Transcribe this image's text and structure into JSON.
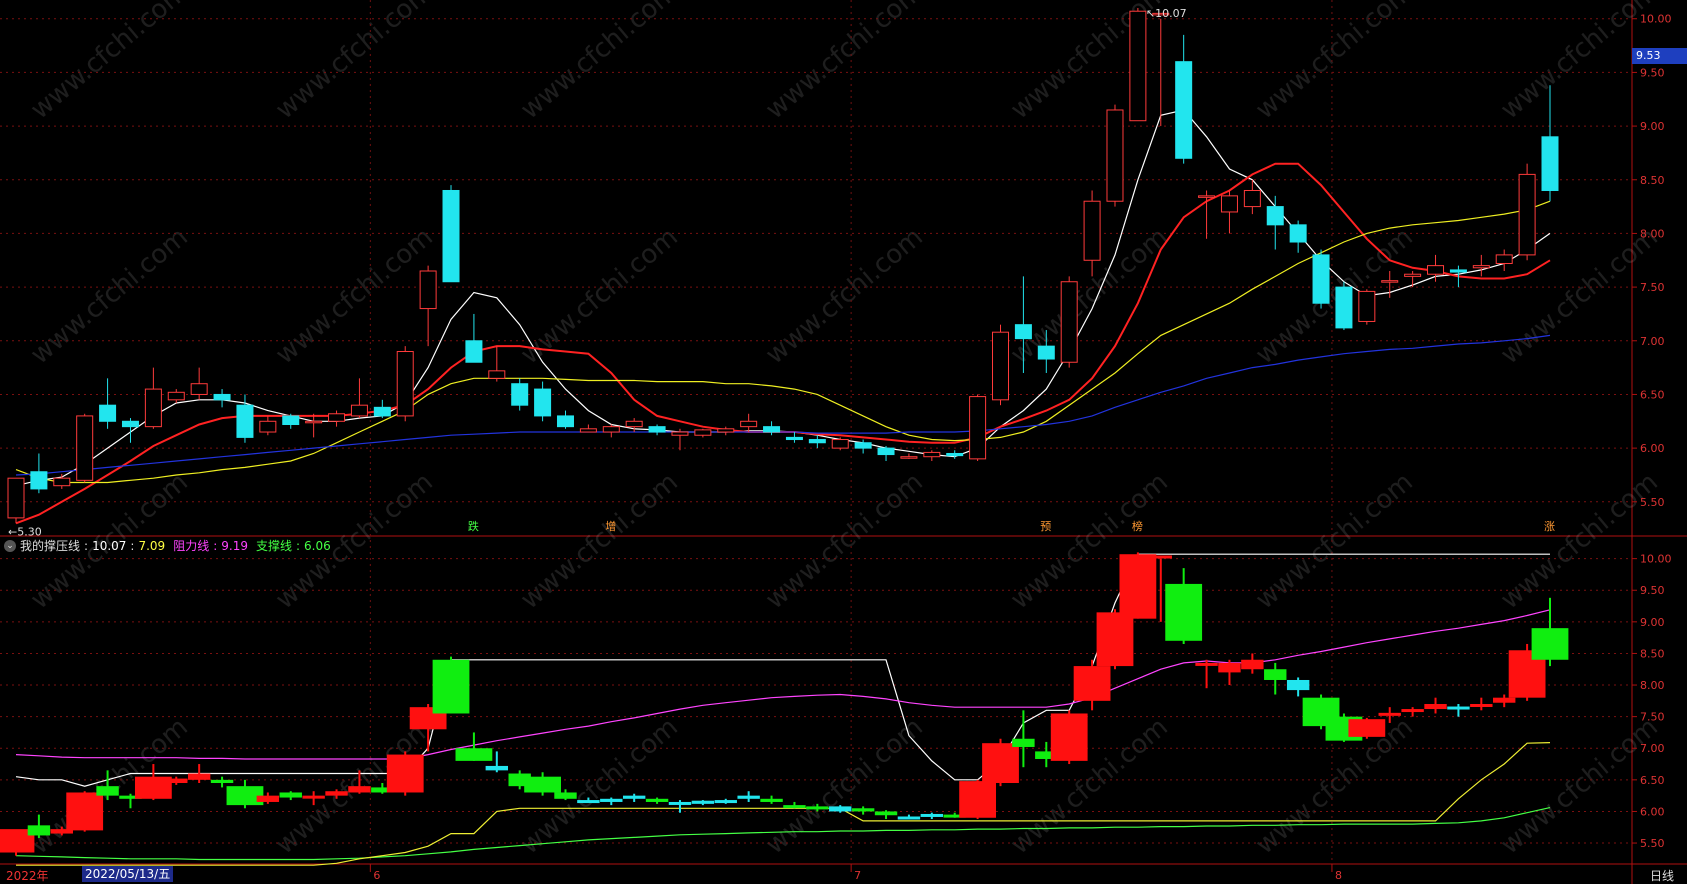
{
  "price_tag": "9.53",
  "indicator_legend": {
    "name": "我的撑压线",
    "val1": "10.07",
    "val2": "7.09",
    "res_label": "阻力线",
    "res_val": "9.19",
    "sup_label": "支撑线",
    "sup_val": "6.06",
    "colors": {
      "name": "#dddddd",
      "val2": "#ffff44",
      "res": "#ff44ff",
      "sup": "#44ff44"
    }
  },
  "bottom_bar": {
    "year": "2022年",
    "date": "2022/05/13/五",
    "period": "日线"
  },
  "month_labels": [
    "6",
    "7",
    "8"
  ],
  "markers": [
    {
      "text": "跌",
      "color": "#44ff44",
      "index": 20
    },
    {
      "text": "增",
      "color": "#ff9933",
      "index": 26
    },
    {
      "text": "预",
      "color": "#ff9933",
      "index": 45
    },
    {
      "text": "榜",
      "color": "#ff9933",
      "index": 49
    },
    {
      "text": "涨",
      "color": "#ff9933",
      "index": 67
    }
  ],
  "annotations": {
    "high": "10.07",
    "low": "5.30"
  },
  "watermark": "www.cfchi.com",
  "chart_data": [
    {
      "type": "candlestick",
      "ylim": [
        5.2,
        10.1
      ],
      "yticks": [
        "10.00",
        "9.50",
        "9.00",
        "8.50",
        "8.00",
        "7.50",
        "7.00",
        "6.50",
        "6.00",
        "5.50"
      ],
      "ohlc": [
        [
          5.35,
          5.72,
          5.3,
          5.7
        ],
        [
          5.78,
          5.62,
          5.58,
          5.95
        ],
        [
          5.65,
          5.72,
          5.62,
          5.76
        ],
        [
          5.7,
          6.3,
          5.68,
          6.32
        ],
        [
          6.4,
          6.25,
          6.18,
          6.65
        ],
        [
          6.25,
          6.2,
          6.05,
          6.28
        ],
        [
          6.2,
          6.55,
          6.18,
          6.75
        ],
        [
          6.45,
          6.52,
          6.42,
          6.55
        ],
        [
          6.5,
          6.6,
          6.45,
          6.75
        ],
        [
          6.5,
          6.45,
          6.38,
          6.55
        ],
        [
          6.4,
          6.1,
          6.05,
          6.5
        ],
        [
          6.15,
          6.25,
          6.12,
          6.3
        ],
        [
          6.3,
          6.22,
          6.18,
          6.32
        ],
        [
          6.25,
          6.25,
          6.1,
          6.32
        ],
        [
          6.25,
          6.32,
          6.2,
          6.35
        ],
        [
          6.3,
          6.4,
          6.28,
          6.65
        ],
        [
          6.38,
          6.3,
          6.28,
          6.45
        ],
        [
          6.3,
          6.9,
          6.25,
          6.95
        ],
        [
          7.3,
          7.65,
          6.95,
          7.7
        ],
        [
          8.4,
          7.55,
          7.55,
          8.45
        ],
        [
          7.0,
          6.8,
          6.8,
          7.25
        ],
        [
          6.65,
          6.72,
          6.62,
          6.95
        ],
        [
          6.6,
          6.4,
          6.35,
          6.65
        ],
        [
          6.55,
          6.3,
          6.25,
          6.62
        ],
        [
          6.3,
          6.2,
          6.18,
          6.35
        ],
        [
          6.15,
          6.18,
          6.15,
          6.22
        ],
        [
          6.15,
          6.2,
          6.1,
          6.22
        ],
        [
          6.2,
          6.25,
          6.15,
          6.28
        ],
        [
          6.2,
          6.15,
          6.12,
          6.22
        ],
        [
          6.12,
          6.15,
          5.98,
          6.18
        ],
        [
          6.12,
          6.17,
          6.1,
          6.18
        ],
        [
          6.15,
          6.18,
          6.12,
          6.2
        ],
        [
          6.2,
          6.25,
          6.15,
          6.32
        ],
        [
          6.2,
          6.15,
          6.12,
          6.25
        ],
        [
          6.1,
          6.08,
          6.05,
          6.15
        ],
        [
          6.08,
          6.05,
          6.0,
          6.12
        ],
        [
          6.0,
          6.08,
          5.98,
          6.1
        ],
        [
          6.05,
          6.0,
          5.95,
          6.08
        ],
        [
          6.0,
          5.94,
          5.88,
          6.02
        ],
        [
          5.92,
          5.92,
          5.9,
          5.95
        ],
        [
          5.92,
          5.96,
          5.88,
          5.98
        ],
        [
          5.95,
          5.93,
          5.9,
          5.98
        ],
        [
          5.9,
          6.48,
          5.88,
          6.5
        ],
        [
          6.45,
          7.08,
          6.4,
          7.15
        ],
        [
          7.15,
          7.02,
          6.7,
          7.6
        ],
        [
          6.95,
          6.83,
          6.7,
          7.1
        ],
        [
          6.8,
          7.55,
          6.75,
          7.6
        ],
        [
          7.75,
          8.3,
          7.6,
          8.4
        ],
        [
          8.3,
          9.15,
          8.25,
          9.2
        ],
        [
          9.05,
          10.07,
          9.05,
          10.1
        ],
        [
          10.05,
          10.05,
          9.0,
          10.0
        ],
        [
          9.6,
          8.7,
          8.65,
          9.85
        ],
        [
          8.35,
          8.35,
          7.95,
          8.4
        ],
        [
          8.2,
          8.35,
          8.0,
          8.4
        ],
        [
          8.25,
          8.4,
          8.18,
          8.5
        ],
        [
          8.25,
          8.08,
          7.85,
          8.35
        ],
        [
          8.08,
          7.92,
          7.82,
          8.12
        ],
        [
          7.8,
          7.35,
          7.3,
          7.85
        ],
        [
          7.5,
          7.12,
          7.1,
          7.55
        ],
        [
          7.18,
          7.46,
          7.15,
          7.48
        ],
        [
          7.55,
          7.56,
          7.4,
          7.65
        ],
        [
          7.6,
          7.62,
          7.5,
          7.65
        ],
        [
          7.62,
          7.7,
          7.55,
          7.8
        ],
        [
          7.66,
          7.64,
          7.5,
          7.7
        ],
        [
          7.68,
          7.7,
          7.6,
          7.8
        ],
        [
          7.72,
          7.8,
          7.65,
          7.85
        ],
        [
          7.8,
          8.55,
          7.75,
          8.65
        ],
        [
          8.9,
          8.4,
          8.3,
          9.38
        ]
      ],
      "ma": [
        {
          "color": "#ffffff",
          "values": [
            5.65,
            5.7,
            5.73,
            5.85,
            6.0,
            6.15,
            6.3,
            6.42,
            6.45,
            6.45,
            6.42,
            6.35,
            6.3,
            6.25,
            6.25,
            6.28,
            6.3,
            6.42,
            6.75,
            7.2,
            7.45,
            7.4,
            7.15,
            6.8,
            6.55,
            6.35,
            6.22,
            6.18,
            6.17,
            6.15,
            6.15,
            6.15,
            6.16,
            6.16,
            6.15,
            6.12,
            6.08,
            6.05,
            6.0,
            5.97,
            5.94,
            5.92,
            6.0,
            6.2,
            6.35,
            6.55,
            6.9,
            7.3,
            7.8,
            8.5,
            9.1,
            9.15,
            8.9,
            8.6,
            8.5,
            8.25,
            8.0,
            7.75,
            7.55,
            7.42,
            7.45,
            7.52,
            7.6,
            7.62,
            7.66,
            7.72,
            7.85,
            8.0
          ]
        },
        {
          "color": "#ff2222",
          "values": [
            5.3,
            5.38,
            5.5,
            5.62,
            5.75,
            5.88,
            6.02,
            6.12,
            6.22,
            6.28,
            6.3,
            6.3,
            6.3,
            6.3,
            6.3,
            6.32,
            6.35,
            6.4,
            6.55,
            6.75,
            6.9,
            6.95,
            6.95,
            6.92,
            6.9,
            6.88,
            6.7,
            6.45,
            6.3,
            6.25,
            6.2,
            6.17,
            6.15,
            6.15,
            6.15,
            6.13,
            6.12,
            6.1,
            6.08,
            6.06,
            6.05,
            6.05,
            6.1,
            6.2,
            6.27,
            6.35,
            6.45,
            6.65,
            6.95,
            7.35,
            7.85,
            8.15,
            8.3,
            8.4,
            8.55,
            8.65,
            8.65,
            8.45,
            8.2,
            7.95,
            7.75,
            7.68,
            7.65,
            7.6,
            7.58,
            7.58,
            7.62,
            7.75
          ]
        },
        {
          "color": "#eeee22",
          "values": [
            5.8,
            5.72,
            5.68,
            5.68,
            5.68,
            5.7,
            5.72,
            5.75,
            5.77,
            5.8,
            5.82,
            5.85,
            5.88,
            5.95,
            6.05,
            6.15,
            6.25,
            6.35,
            6.5,
            6.6,
            6.65,
            6.65,
            6.65,
            6.65,
            6.64,
            6.63,
            6.63,
            6.63,
            6.62,
            6.62,
            6.62,
            6.6,
            6.6,
            6.58,
            6.55,
            6.5,
            6.4,
            6.3,
            6.2,
            6.12,
            6.08,
            6.07,
            6.08,
            6.1,
            6.15,
            6.25,
            6.4,
            6.55,
            6.7,
            6.88,
            7.05,
            7.15,
            7.25,
            7.35,
            7.48,
            7.6,
            7.72,
            7.82,
            7.92,
            8.0,
            8.05,
            8.08,
            8.1,
            8.12,
            8.15,
            8.18,
            8.22,
            8.3
          ]
        },
        {
          "color": "#2233dd",
          "values": [
            5.75,
            5.76,
            5.78,
            5.8,
            5.82,
            5.84,
            5.86,
            5.88,
            5.9,
            5.92,
            5.94,
            5.96,
            5.98,
            6.0,
            6.02,
            6.04,
            6.06,
            6.08,
            6.1,
            6.12,
            6.13,
            6.14,
            6.15,
            6.15,
            6.15,
            6.15,
            6.15,
            6.15,
            6.15,
            6.15,
            6.15,
            6.15,
            6.15,
            6.15,
            6.15,
            6.14,
            6.14,
            6.14,
            6.14,
            6.15,
            6.15,
            6.15,
            6.16,
            6.18,
            6.2,
            6.22,
            6.25,
            6.3,
            6.38,
            6.45,
            6.52,
            6.58,
            6.65,
            6.7,
            6.75,
            6.78,
            6.82,
            6.85,
            6.88,
            6.9,
            6.92,
            6.93,
            6.95,
            6.97,
            6.98,
            7.0,
            7.02,
            7.05
          ]
        }
      ]
    },
    {
      "type": "line",
      "ylim": [
        5.2,
        10.2
      ],
      "yticks": [
        "10.00",
        "9.50",
        "9.00",
        "8.50",
        "8.00",
        "7.50",
        "7.00",
        "6.50",
        "6.00",
        "5.50"
      ],
      "series": [
        {
          "name": "我的撑压线",
          "color": "#ffffff",
          "values": [
            6.55,
            6.5,
            6.5,
            6.4,
            6.5,
            6.6,
            6.6,
            6.6,
            6.6,
            6.6,
            6.6,
            6.6,
            6.6,
            6.6,
            6.6,
            6.6,
            6.6,
            6.6,
            7.0,
            8.4,
            8.4,
            8.4,
            8.4,
            8.4,
            8.4,
            8.4,
            8.4,
            8.4,
            8.4,
            8.4,
            8.4,
            8.4,
            8.4,
            8.4,
            8.4,
            8.4,
            8.4,
            8.4,
            8.4,
            7.2,
            6.8,
            6.5,
            6.5,
            6.8,
            7.4,
            7.6,
            7.6,
            8.3,
            9.3,
            10.07,
            10.07,
            10.07,
            10.07,
            10.07,
            10.07,
            10.07,
            10.07,
            10.07,
            10.07,
            10.07,
            10.07,
            10.07,
            10.07,
            10.07,
            10.07,
            10.07,
            10.07,
            10.07
          ]
        },
        {
          "name": "阻力线",
          "color": "#ff44ff",
          "values": [
            6.9,
            6.88,
            6.86,
            6.85,
            6.85,
            6.85,
            6.85,
            6.85,
            6.84,
            6.84,
            6.83,
            6.83,
            6.83,
            6.83,
            6.83,
            6.83,
            6.83,
            6.83,
            6.9,
            6.98,
            7.05,
            7.12,
            7.18,
            7.24,
            7.3,
            7.35,
            7.42,
            7.48,
            7.55,
            7.62,
            7.68,
            7.72,
            7.76,
            7.8,
            7.82,
            7.84,
            7.85,
            7.82,
            7.78,
            7.72,
            7.68,
            7.65,
            7.65,
            7.65,
            7.65,
            7.65,
            7.7,
            7.8,
            7.95,
            8.1,
            8.25,
            8.35,
            8.38,
            8.35,
            8.35,
            8.4,
            8.47,
            8.53,
            8.6,
            8.67,
            8.73,
            8.79,
            8.85,
            8.9,
            8.96,
            9.02,
            9.1,
            9.19
          ]
        },
        {
          "name": "支撑线",
          "color": "#44ff44",
          "values": [
            5.3,
            5.29,
            5.28,
            5.27,
            5.26,
            5.25,
            5.25,
            5.25,
            5.24,
            5.24,
            5.24,
            5.24,
            5.24,
            5.24,
            5.25,
            5.26,
            5.28,
            5.3,
            5.33,
            5.36,
            5.4,
            5.43,
            5.46,
            5.49,
            5.52,
            5.55,
            5.57,
            5.59,
            5.61,
            5.63,
            5.64,
            5.65,
            5.66,
            5.67,
            5.68,
            5.68,
            5.69,
            5.69,
            5.7,
            5.7,
            5.71,
            5.71,
            5.72,
            5.72,
            5.73,
            5.73,
            5.74,
            5.74,
            5.75,
            5.75,
            5.76,
            5.76,
            5.77,
            5.77,
            5.78,
            5.78,
            5.79,
            5.79,
            5.8,
            5.8,
            5.8,
            5.8,
            5.81,
            5.82,
            5.85,
            5.9,
            5.98,
            6.06
          ]
        },
        {
          "name": "",
          "color": "#eeee33",
          "values": [
            5.15,
            5.15,
            5.15,
            5.15,
            5.15,
            5.15,
            5.15,
            5.15,
            5.15,
            5.15,
            5.15,
            5.15,
            5.15,
            5.15,
            5.18,
            5.25,
            5.3,
            5.35,
            5.45,
            5.65,
            5.65,
            6.0,
            6.05,
            6.05,
            6.05,
            6.05,
            6.05,
            6.05,
            6.05,
            6.05,
            6.05,
            6.05,
            6.05,
            6.05,
            6.05,
            6.05,
            6.05,
            5.85,
            5.85,
            5.85,
            5.85,
            5.85,
            5.85,
            5.85,
            5.85,
            5.85,
            5.85,
            5.85,
            5.85,
            5.85,
            5.85,
            5.85,
            5.85,
            5.85,
            5.85,
            5.85,
            5.85,
            5.85,
            5.85,
            5.85,
            5.85,
            5.85,
            5.85,
            6.2,
            6.5,
            6.75,
            7.08,
            7.09
          ]
        }
      ]
    }
  ]
}
